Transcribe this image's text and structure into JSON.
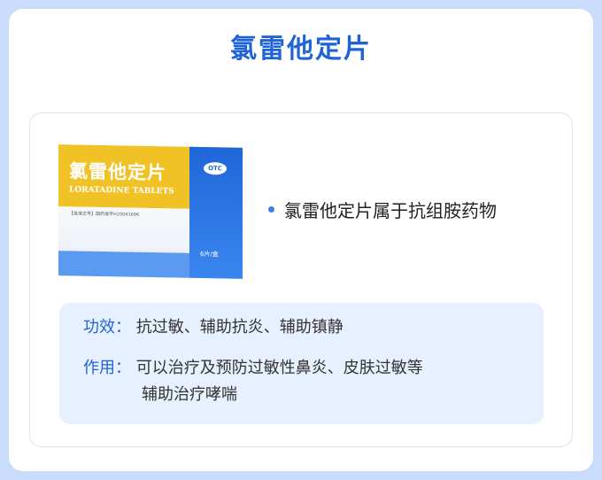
{
  "title": "氯雷他定片",
  "product_box": {
    "name": "氯雷他定片",
    "english_name": "LORATADINE TABLETS",
    "badge": "OTC",
    "approval_line": "【批准文号】国药准字H20041696",
    "count": "6片/盒"
  },
  "fact": "氯雷他定片属于抗组胺药物",
  "info": {
    "efficacy_label": "功效：",
    "efficacy_text": "抗过敏、辅助抗炎、辅助镇静",
    "usage_label": "作用：",
    "usage_text_line1": "可以治疗及预防过敏性鼻炎、皮肤过敏等",
    "usage_text_line2": "辅助治疗哮喘"
  },
  "colors": {
    "accent": "#1f63d6",
    "background": "#c9dcfb",
    "panel": "#e7f0fe"
  }
}
